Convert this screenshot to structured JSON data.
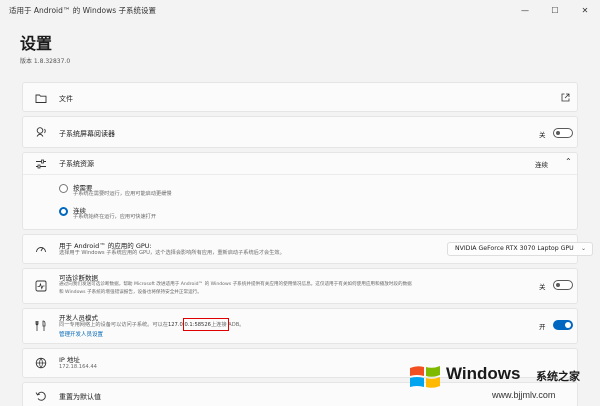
{
  "window": {
    "title": "适用于 Android™ 的 Windows 子系统设置",
    "controls": {
      "minimize": "—",
      "maximize": "☐",
      "close": "✕"
    }
  },
  "page": {
    "title": "设置",
    "version": "版本 1.8.32837.0"
  },
  "files": {
    "label": "文件",
    "icon": "folder-icon",
    "action_icon": "open-external-icon"
  },
  "screen_reader": {
    "label": "子系统屏幕阅读器",
    "state": "关",
    "toggle_on": false,
    "icon": "screen-reader-icon"
  },
  "resources": {
    "label": "子系统资源",
    "state": "连续",
    "icon": "sliders-icon",
    "options": [
      {
        "label": "按需要",
        "desc": "子系统在需要时运行，应用可能启动更缓慢",
        "selected": false
      },
      {
        "label": "连续",
        "desc": "子系统始终在运行，应用可快速打开",
        "selected": true
      }
    ]
  },
  "gpu": {
    "label": "用于 Android™ 的应用的 GPU:",
    "desc": "选择用于 Windows 子系统应用的 GPU，这个选择会影响所有应用，重新启动子系统后才会生效。",
    "selected": "NVIDIA GeForce RTX 3070 Laptop GPU",
    "icon": "gauge-icon"
  },
  "diagnostics": {
    "label": "可选诊断数据",
    "desc_line1": "通过向我们发送可选诊断数据，帮助 Microsoft 改进适用于 Android™ 的 Windows 子系统并提供有关应用的使用情况信息。这仅适用于有关如何使用应用和播放时段的数据",
    "desc_line2": "和 Windows 子系统的增强错误报告，设备也将保持安全并正常运行。",
    "state": "关",
    "toggle_on": false,
    "icon": "diagnostics-icon"
  },
  "developer": {
    "label": "开发人员模式",
    "desc_before": "同一专用网络上的设备可以访问子系统。可以在",
    "address": "127.0.0.1:58526",
    "desc_after": "上连接 ADB。",
    "link": "管理开发人员设置",
    "state": "开",
    "toggle_on": true,
    "icon": "tools-icon",
    "highlight_color": "#e00000"
  },
  "ip": {
    "label": "IP 地址",
    "value": "172.18.164.44",
    "icon": "globe-icon"
  },
  "reset": {
    "label": "重置为默认值",
    "icon": "reset-icon"
  },
  "watermark": {
    "brand": "Windows",
    "suffix": "系统之家",
    "url": "www.bjjmlv.com"
  },
  "colors": {
    "accent": "#0067c0",
    "link": "#0066b4",
    "background": "#f3f3f3",
    "card": "#fbfbfb"
  }
}
